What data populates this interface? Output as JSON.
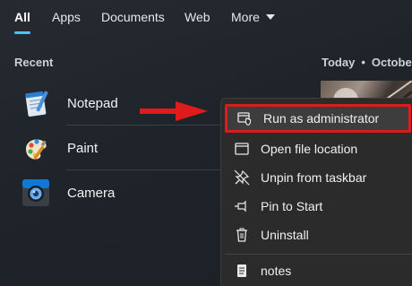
{
  "tabs": [
    {
      "label": "All"
    },
    {
      "label": "Apps"
    },
    {
      "label": "Documents"
    },
    {
      "label": "Web"
    },
    {
      "label": "More"
    }
  ],
  "recent": {
    "header": "Recent",
    "apps": [
      {
        "label": "Notepad",
        "icon": "notepad-icon"
      },
      {
        "label": "Paint",
        "icon": "paint-icon"
      },
      {
        "label": "Camera",
        "icon": "camera-icon"
      }
    ]
  },
  "date_header": {
    "today": "Today",
    "separator": "•",
    "month": "October"
  },
  "context_menu": {
    "items": [
      {
        "label": "Run as administrator",
        "icon": "shield-icon",
        "highlighted": true
      },
      {
        "label": "Open file location",
        "icon": "folder-icon"
      },
      {
        "label": "Unpin from taskbar",
        "icon": "unpin-icon"
      },
      {
        "label": "Pin to Start",
        "icon": "pin-icon"
      },
      {
        "label": "Uninstall",
        "icon": "trash-icon"
      },
      {
        "label": "notes",
        "icon": "document-icon"
      }
    ]
  },
  "colors": {
    "accent": "#4cc2ff",
    "annotation": "#e01b1b",
    "menu_bg": "#2b2b2b"
  }
}
